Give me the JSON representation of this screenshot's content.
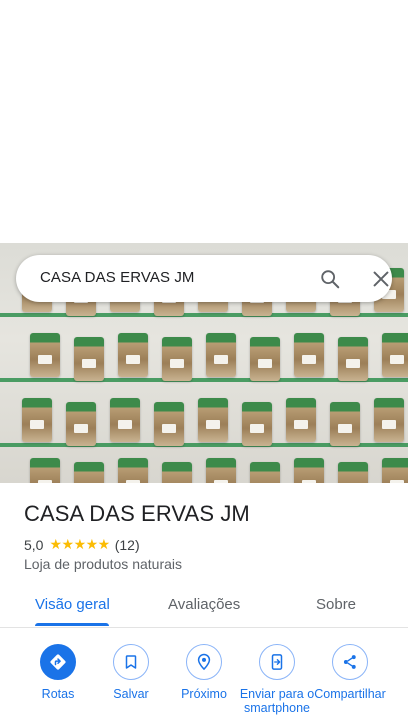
{
  "search": {
    "query": "CASA DAS ERVAS JM"
  },
  "place": {
    "name": "CASA DAS ERVAS JM",
    "rating": "5,0",
    "stars": "★★★★★",
    "review_count": "(12)",
    "category": "Loja de produtos naturais"
  },
  "tabs": [
    {
      "label": "Visão geral",
      "active": true
    },
    {
      "label": "Avaliações",
      "active": false
    },
    {
      "label": "Sobre",
      "active": false
    }
  ],
  "actions": [
    {
      "label": "Rotas",
      "icon": "directions-icon"
    },
    {
      "label": "Salvar",
      "icon": "bookmark-icon"
    },
    {
      "label": "Próximo",
      "icon": "nearby-icon"
    },
    {
      "label": "Enviar para o smartphone",
      "icon": "send-to-phone-icon"
    },
    {
      "label": "Compartilhar",
      "icon": "share-icon"
    }
  ],
  "colors": {
    "accent": "#1a73e8",
    "stars": "#fbbc04"
  }
}
